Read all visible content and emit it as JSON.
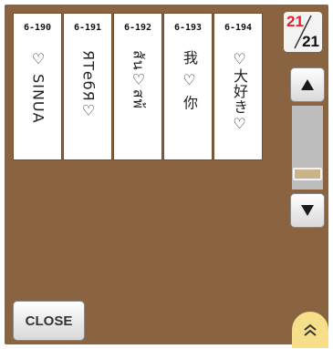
{
  "cards": [
    {
      "number": "6-190",
      "text": "♡ SINUA"
    },
    {
      "number": "6-191",
      "text": "ЯТебЯ♡"
    },
    {
      "number": "6-192",
      "text": "สัน♡สพ้"
    },
    {
      "number": "6-193",
      "text": "我 ♡ 你"
    },
    {
      "number": "6-194",
      "text": "♡大好き♡"
    }
  ],
  "pagination": {
    "current": "21",
    "total": "21"
  },
  "buttons": {
    "close": "CLOSE"
  },
  "scrollbar": {
    "position": 0.87
  },
  "colors": {
    "panel_bg": "#8a6440",
    "page_current": "#e5202a",
    "expand_button": "#f7df8a",
    "thumb": "#c9b48a"
  },
  "icons": {
    "scroll_up": "triangle-up-icon",
    "scroll_down": "triangle-down-icon",
    "expand": "double-chevron-up-icon"
  }
}
